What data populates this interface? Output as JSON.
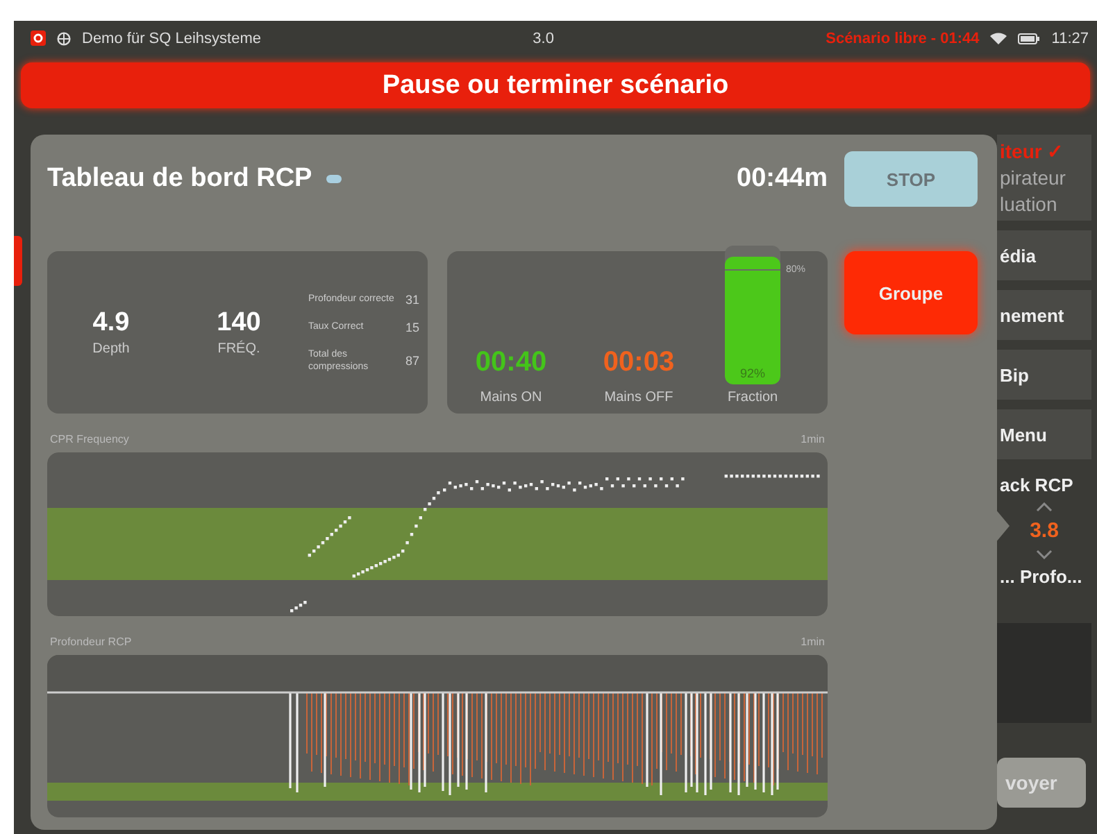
{
  "status_bar": {
    "app": "Demo für SQ Leihsysteme",
    "version": "3.0",
    "scenario": "Scénario libre - 01:44",
    "time": "11:27"
  },
  "banner": "Pause ou terminer scénario",
  "modal": {
    "title": "Tableau de bord RCP",
    "timer": "00:44m",
    "stop": "STOP",
    "group": "Groupe",
    "depth": {
      "value": "4.9",
      "label": "Depth"
    },
    "frequency": {
      "value": "140",
      "label": "FRÉQ."
    },
    "details": [
      {
        "label": "Profondeur correcte",
        "value": "31"
      },
      {
        "label": "Taux Correct",
        "value": "15"
      },
      {
        "label": "Total des compressions",
        "value": "87"
      }
    ],
    "hands_on": {
      "value": "00:40",
      "label": "Mains ON"
    },
    "hands_off": {
      "value": "00:03",
      "label": "Mains OFF"
    },
    "fraction": {
      "value": "92%",
      "label": "Fraction",
      "level": 0.92,
      "target": "80%"
    },
    "charts": [
      {
        "kind": "dots",
        "title": "CPR Frequency",
        "scale": "1min"
      },
      {
        "kind": "bars",
        "title": "Profondeur RCP",
        "scale": "1min"
      }
    ]
  },
  "side_menu": [
    {
      "kind": "header",
      "lines": [
        "iteur ✓",
        "pirateur",
        "luation"
      ]
    },
    {
      "kind": "button",
      "label": "édia"
    },
    {
      "kind": "button",
      "label": "nement"
    },
    {
      "kind": "button",
      "label": "Bip"
    },
    {
      "kind": "button",
      "label": "Menu"
    },
    {
      "kind": "stepper",
      "label": "ack RCP",
      "value": "3.8",
      "caption": "... Profo..."
    },
    {
      "kind": "send",
      "label": "voyer"
    }
  ]
}
